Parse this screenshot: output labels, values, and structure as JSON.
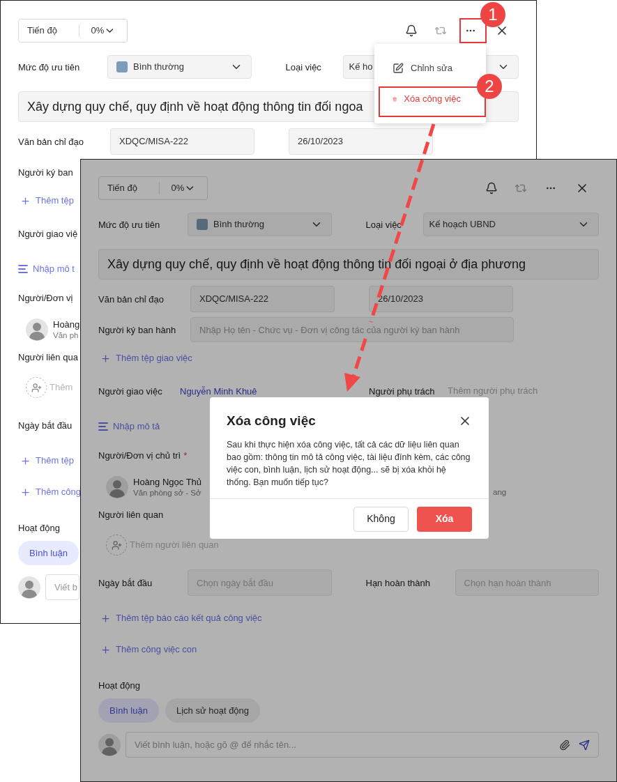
{
  "back_window": {
    "progress": {
      "label": "Tiến độ",
      "value": "0%"
    },
    "priority": {
      "label": "Mức độ ưu tiên",
      "value": "Bình thường",
      "color": "#7b9cbb"
    },
    "task_type": {
      "label": "Loại việc",
      "value": "Kế ho"
    },
    "title": "Xây dựng quy chế, quy định về hoạt động thông tin đối ngoa",
    "document": {
      "label": "Văn bản chỉ đạo",
      "value": "XDQC/MISA-222",
      "date": "26/10/2023"
    },
    "signer": {
      "label": "Người ký ban"
    },
    "add_assign_file": "Thêm tệp",
    "assigner": {
      "label": "Người giao việ"
    },
    "description_link": "Nhập mô t",
    "host": {
      "label": "Người/Đơn vị"
    },
    "host_person": {
      "name": "Hoàng",
      "subtitle": "Văn ph"
    },
    "related": {
      "label": "Người liên qua"
    },
    "add_related": "Thêm",
    "start": {
      "label": "Ngày bắt đầu"
    },
    "add_report": "Thêm tệp",
    "add_subtask": "Thêm công",
    "activity": "Hoạt động",
    "tabs": [
      {
        "label": "Bình luận",
        "selected": true
      }
    ],
    "comment": {
      "placeholder": "Viết b"
    },
    "dimmed": false
  },
  "menu": {
    "items": [
      {
        "label": "Chỉnh sửa",
        "kind": "edit"
      },
      {
        "label": "Xóa công việc",
        "kind": "delete"
      }
    ]
  },
  "callouts": [
    "1",
    "2"
  ],
  "front_window": {
    "progress": {
      "label": "Tiến độ",
      "value": "0%"
    },
    "priority": {
      "label": "Mức độ ưu tiên",
      "value": "Bình thường",
      "color": "#56697d"
    },
    "task_type": {
      "label": "Loại việc",
      "value": "Kế hoạch UBND"
    },
    "title": "Xây dựng quy chế, quy định về hoạt động thông tin đối ngoại ở địa phương",
    "document": {
      "label": "Văn bản chỉ đạo",
      "value": "XDQC/MISA-222",
      "date": "26/10/2023"
    },
    "signer": {
      "label": "Người ký ban hành",
      "placeholder": "Nhập Họ tên - Chức vụ - Đơn vị công tác của người ký ban hành"
    },
    "add_assign_file": "Thêm tệp giao việc",
    "assigner": {
      "label": "Người giao việc",
      "name": "Nguyễn Minh Khuê"
    },
    "owner": {
      "label": "Người phụ trách",
      "placeholder": "Thêm người phụ trách"
    },
    "description_link": "Nhập mô tả",
    "host": {
      "label": "Người/Đơn vị chủ trì",
      "required_mark": "*"
    },
    "host_person": {
      "name": "Hoàng Ngọc Thủ",
      "subtitle": "Văn phòng sở - Sở",
      "extra": "ang"
    },
    "related": {
      "label": "Người liên quan"
    },
    "add_related": "Thêm người liên quan",
    "start": {
      "label": "Ngày bắt đầu",
      "placeholder": "Chọn ngày bắt đầu"
    },
    "deadline": {
      "label": "Hạn hoàn thành",
      "placeholder": "Chọn hạn hoàn thành"
    },
    "add_report": "Thêm tệp báo cáo kết quả công việc",
    "add_subtask": "Thêm công việc con",
    "activity": "Hoạt động",
    "tabs": [
      {
        "label": "Bình luận",
        "selected": true
      },
      {
        "label": "Lịch sử hoạt động",
        "selected": false
      }
    ],
    "comment": {
      "placeholder": "Viết bình luận, hoặc gõ @ để nhắc tên..."
    },
    "dimmed": true
  },
  "dialog": {
    "title": "Xóa công việc",
    "message": "Sau khi thực hiện xóa công việc, tất cả các dữ liệu liên quan bao gồm: thông tin mô tả công việc, tài liệu đính kèm, các công việc con, bình luận, lịch sử hoạt động... sẽ bị xóa khỏi hệ thống. Bạn muốn tiếp tục?",
    "buttons": [
      {
        "label": "Không",
        "kind": "secondary"
      },
      {
        "label": "Xóa",
        "kind": "danger"
      }
    ]
  }
}
